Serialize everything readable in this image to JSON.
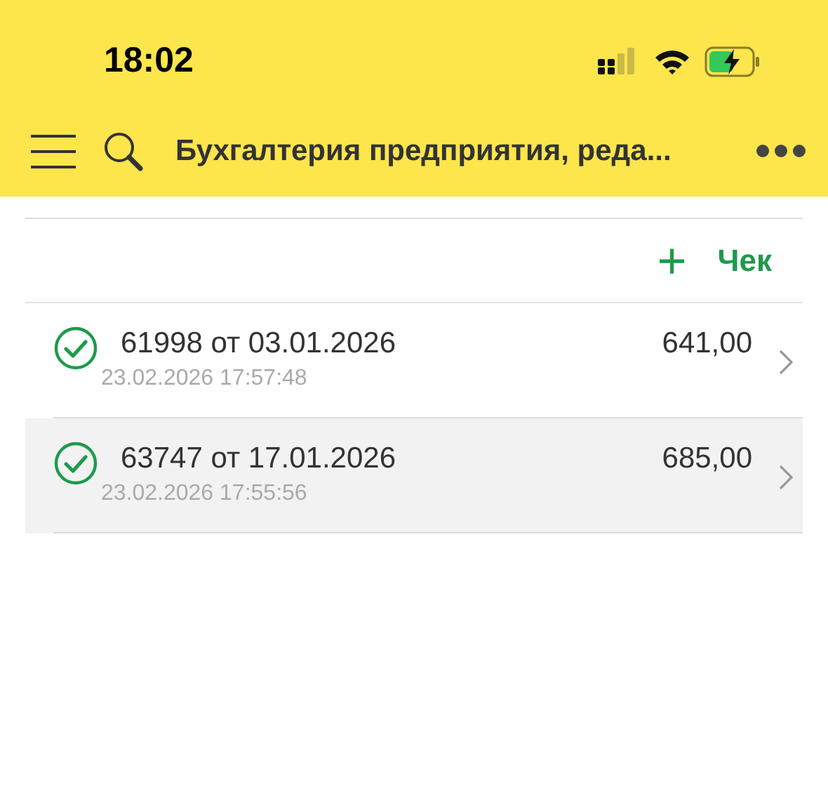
{
  "status_bar": {
    "time": "18:02"
  },
  "header": {
    "title": "Бухгалтерия предприятия, реда..."
  },
  "toolbar": {
    "add_icon": "+",
    "add_label": "Чек"
  },
  "rows": [
    {
      "title": "61998 от 03.01.2026",
      "amount": "641,00",
      "timestamp": "23.02.2026 17:57:48",
      "posted": true,
      "selected": false
    },
    {
      "title": "63747 от 17.01.2026",
      "amount": "685,00",
      "timestamp": "23.02.2026 17:55:56",
      "posted": true,
      "selected": true
    }
  ]
}
